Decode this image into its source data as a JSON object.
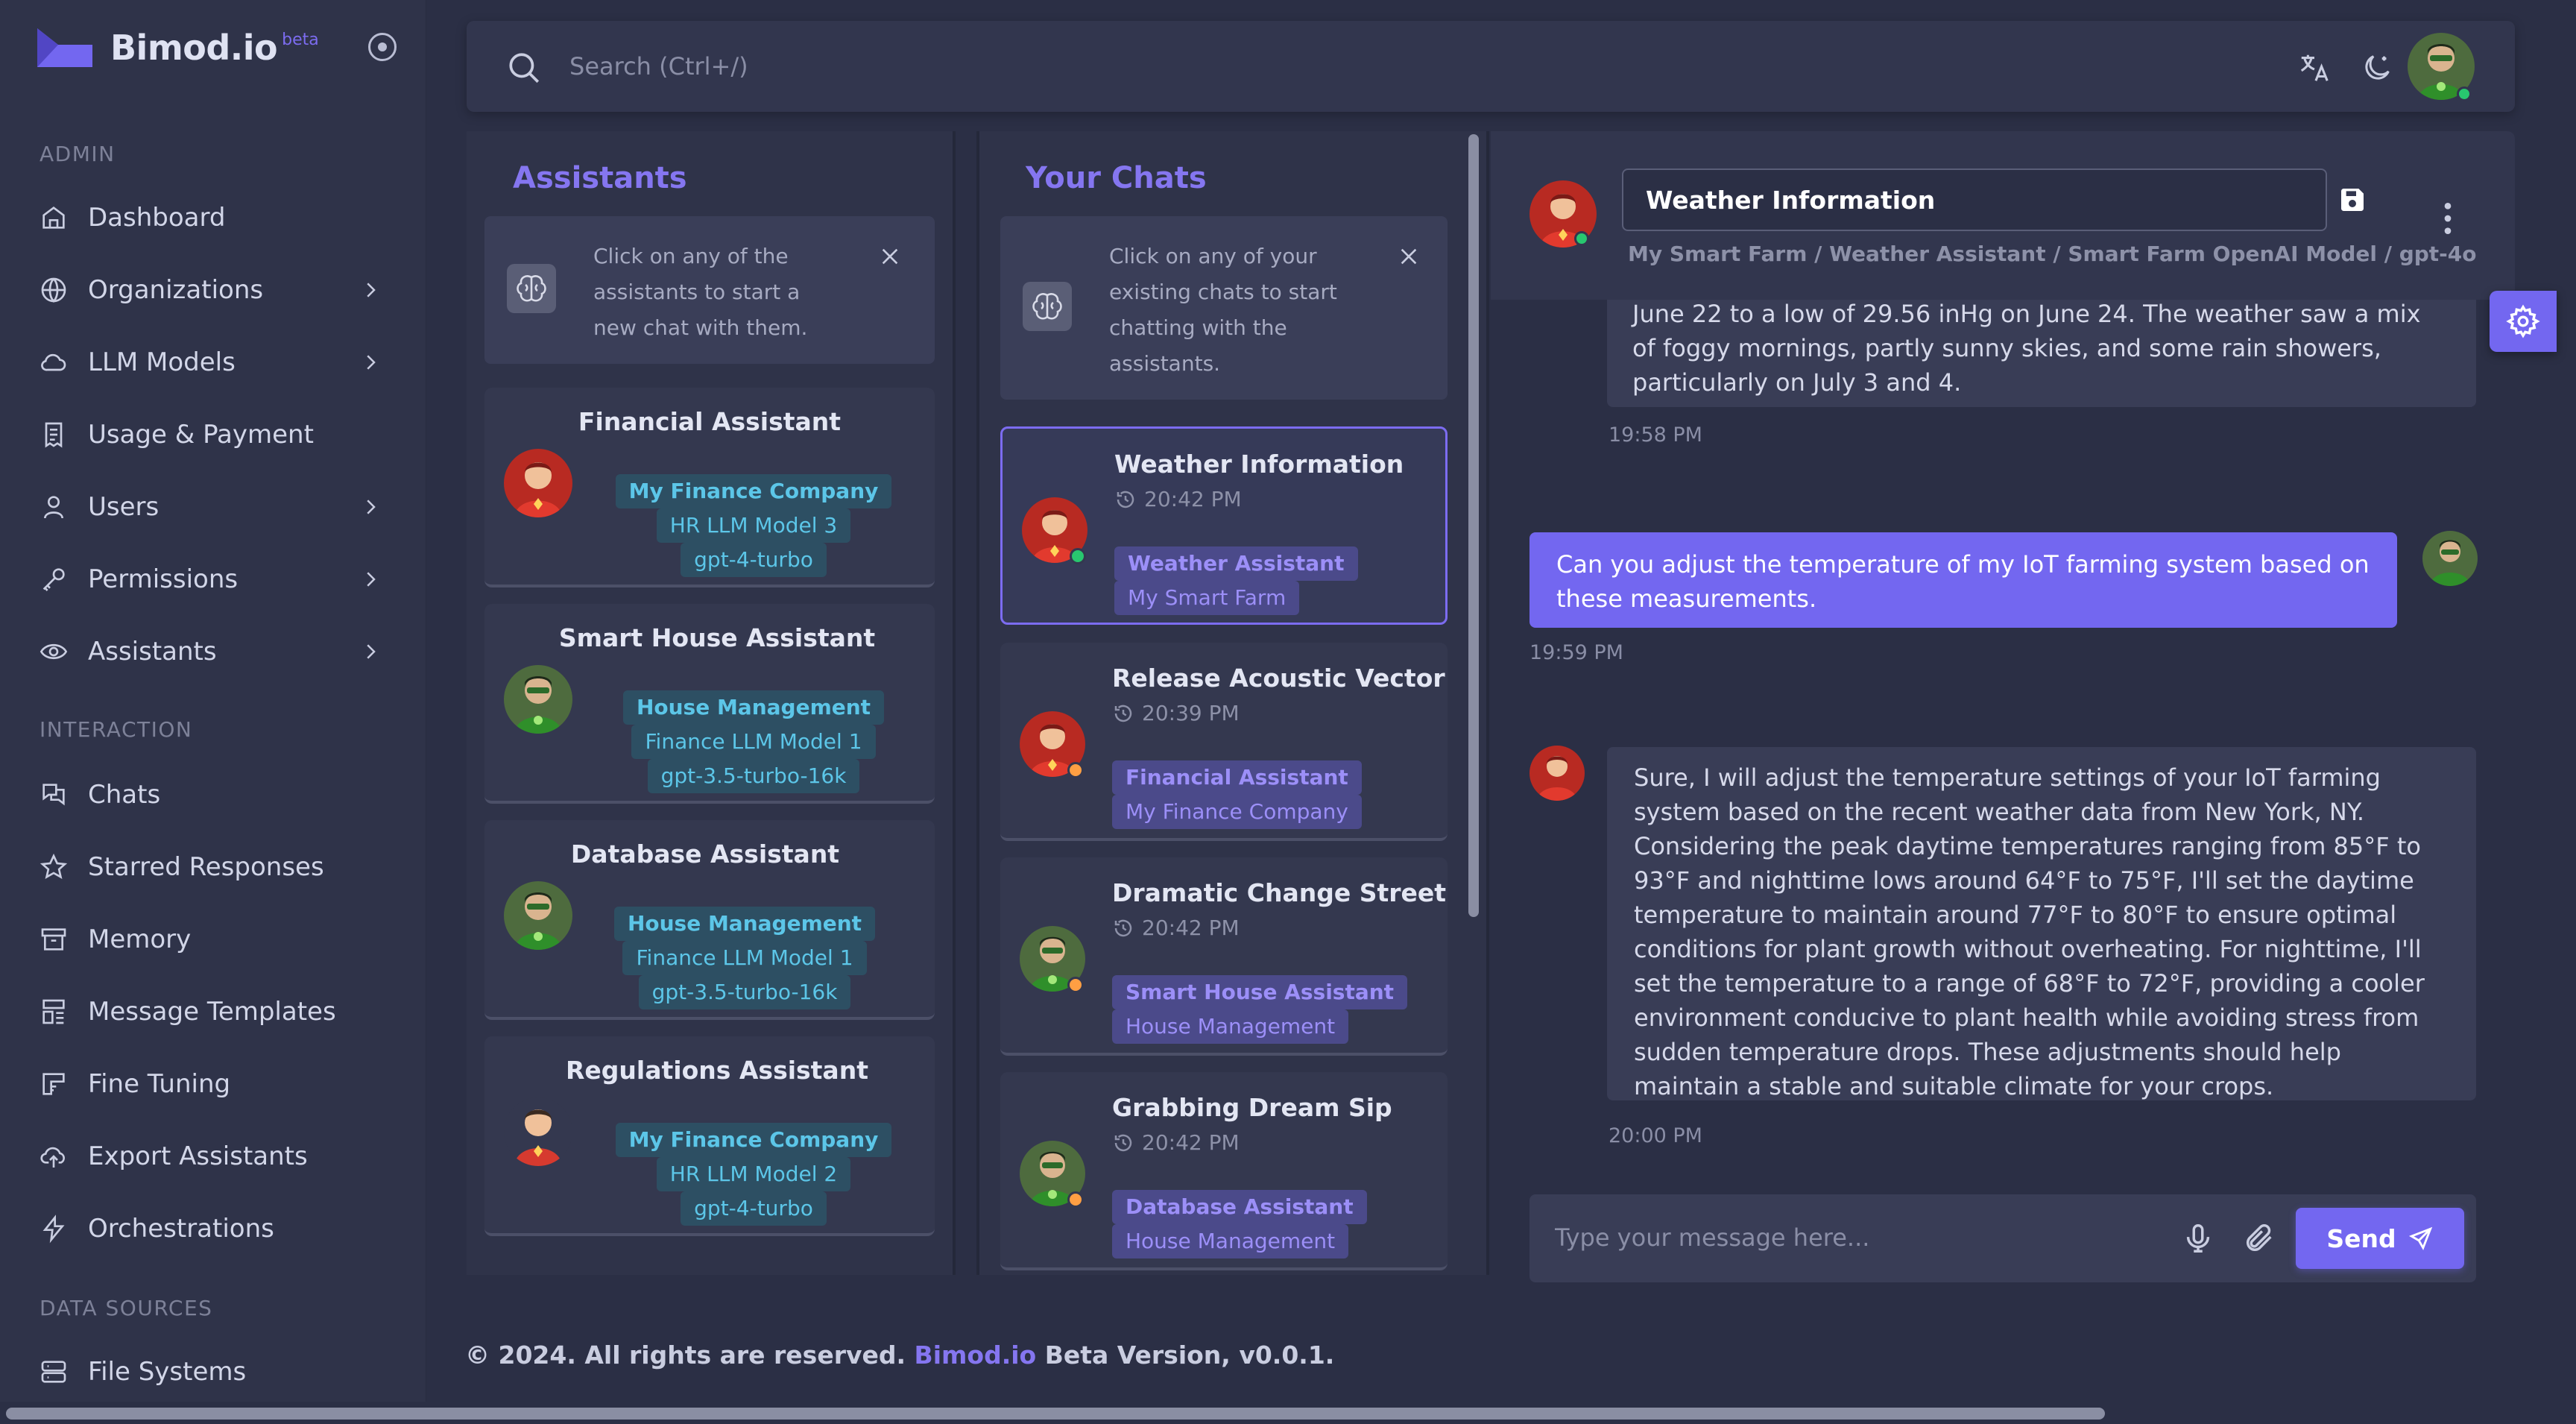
{
  "brand": {
    "name": "Bimod.io",
    "badge": "beta"
  },
  "sidebar": {
    "sections": {
      "admin": "ADMIN",
      "interaction": "INTERACTION",
      "data_sources": "DATA SOURCES"
    },
    "admin_items": [
      {
        "label": "Dashboard",
        "icon": "home-icon"
      },
      {
        "label": "Organizations",
        "icon": "globe-icon",
        "expandable": true
      },
      {
        "label": "LLM Models",
        "icon": "cloud-icon",
        "expandable": true
      },
      {
        "label": "Usage & Payment",
        "icon": "receipt-icon"
      },
      {
        "label": "Users",
        "icon": "user-icon",
        "expandable": true
      },
      {
        "label": "Permissions",
        "icon": "key-icon",
        "expandable": true
      },
      {
        "label": "Assistants",
        "icon": "eye-icon",
        "expandable": true
      }
    ],
    "interaction_items": [
      {
        "label": "Chats",
        "icon": "chat-icon"
      },
      {
        "label": "Starred Responses",
        "icon": "star-icon"
      },
      {
        "label": "Memory",
        "icon": "archive-icon"
      },
      {
        "label": "Message Templates",
        "icon": "template-icon"
      },
      {
        "label": "Fine Tuning",
        "icon": "frame-icon"
      },
      {
        "label": "Export Assistants",
        "icon": "cloud-upload-icon"
      },
      {
        "label": "Orchestrations",
        "icon": "bolt-icon"
      }
    ],
    "data_source_items": [
      {
        "label": "File Systems",
        "icon": "server-icon"
      }
    ]
  },
  "topbar": {
    "search_placeholder": "Search (Ctrl+/)"
  },
  "assistants_panel": {
    "title": "Assistants",
    "info": "Click on any of the assistants to start a new chat with them.",
    "cards": [
      {
        "name": "Financial Assistant",
        "org": "My Finance Company",
        "model": "HR LLM Model 3",
        "engine": "gpt-4-turbo",
        "avatar": "red"
      },
      {
        "name": "Smart House Assistant",
        "org": "House Management",
        "model": "Finance LLM Model 1",
        "engine": "gpt-3.5-turbo-16k",
        "avatar": "green"
      },
      {
        "name": "Database Assistant",
        "org": "House Management",
        "model": "Finance LLM Model 1",
        "engine": "gpt-3.5-turbo-16k",
        "avatar": "green"
      },
      {
        "name": "Regulations Assistant",
        "org": "My Finance Company",
        "model": "HR LLM Model 2",
        "engine": "gpt-4-turbo",
        "avatar": "red"
      }
    ]
  },
  "chats_panel": {
    "title": "Your Chats",
    "info": "Click on any of your existing chats to start chatting with the assistants.",
    "chats": [
      {
        "title": "Weather Information",
        "time": "20:42 PM",
        "assistant": "Weather Assistant",
        "org": "My Smart Farm",
        "avatar": "red",
        "status": "#28c76f",
        "active": true
      },
      {
        "title": "Release Acoustic Vector",
        "time": "20:39 PM",
        "assistant": "Financial Assistant",
        "org": "My Finance Company",
        "avatar": "red",
        "status": "#ff9f43",
        "active": false
      },
      {
        "title": "Dramatic Change Street",
        "time": "20:42 PM",
        "assistant": "Smart House Assistant",
        "org": "House Management",
        "avatar": "green",
        "status": "#ff9f43",
        "active": false
      },
      {
        "title": "Grabbing Dream Sip",
        "time": "20:42 PM",
        "assistant": "Database Assistant",
        "org": "House Management",
        "avatar": "green",
        "status": "#ff9f43",
        "active": false
      }
    ]
  },
  "chat": {
    "title": "Weather Information",
    "breadcrumb": "My Smart Farm / Weather Assistant / Smart Farm OpenAI Model / gpt-4o",
    "messages": [
      {
        "role": "assistant",
        "text": "June 22 to a low of 29.56 inHg on June 24. The weather saw a mix of foggy mornings, partly sunny skies, and some rain showers, particularly on July 3 and 4.",
        "time": "19:58 PM"
      },
      {
        "role": "user",
        "text": "Can you adjust the temperature of my IoT farming system based on these measurements.",
        "time": "19:59 PM"
      },
      {
        "role": "assistant",
        "text": "Sure, I will adjust the temperature settings of your IoT farming system based on the recent weather data from New York, NY. Considering the peak daytime temperatures ranging from 85°F to 93°F and nighttime lows around 64°F to 75°F, I'll set the daytime temperature to maintain around 77°F to 80°F to ensure optimal conditions for plant growth without overheating. For nighttime, I'll set the temperature to a range of 68°F to 72°F, providing a cooler environment conducive to plant health while avoiding stress from sudden temperature drops. These adjustments should help maintain a stable and suitable climate for your crops.",
        "time": "20:00 PM"
      }
    ],
    "composer_placeholder": "Type your message here...",
    "send_label": "Send"
  },
  "footer": {
    "prefix": "© 2024. All rights are reserved.",
    "link": "Bimod.io",
    "suffix": "Beta Version, v0.0.1."
  },
  "colors": {
    "accent": "#7367f0",
    "online": "#28c76f",
    "away": "#ff9f43",
    "tag_cyan": "#5cc6e8"
  }
}
